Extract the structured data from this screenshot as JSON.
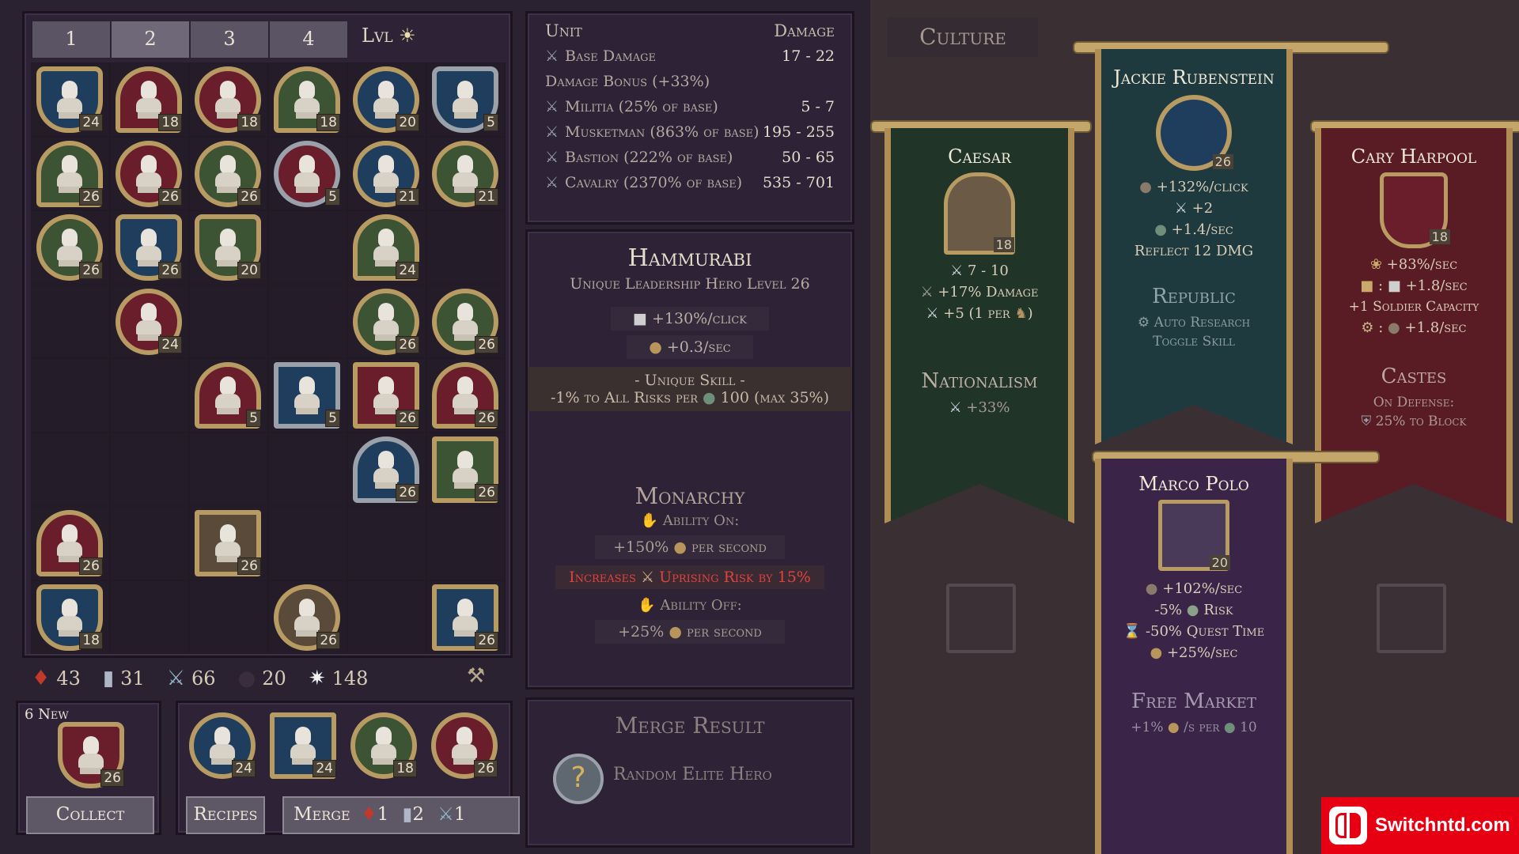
{
  "tabs": [
    "1",
    "2",
    "3",
    "4"
  ],
  "lvl_label": "Lvl",
  "heroes": [
    {
      "r": 0,
      "c": 0,
      "shape": "shield",
      "bg": "blue",
      "frame": "gold",
      "lvl": "24"
    },
    {
      "r": 0,
      "c": 1,
      "shape": "arch",
      "bg": "red",
      "frame": "gold",
      "lvl": "18"
    },
    {
      "r": 0,
      "c": 2,
      "shape": "circle",
      "bg": "red",
      "frame": "gold",
      "lvl": "18"
    },
    {
      "r": 0,
      "c": 3,
      "shape": "arch",
      "bg": "green",
      "frame": "gold",
      "lvl": "18"
    },
    {
      "r": 0,
      "c": 4,
      "shape": "circle",
      "bg": "blue",
      "frame": "gold",
      "lvl": "20"
    },
    {
      "r": 0,
      "c": 5,
      "shape": "shield",
      "bg": "blue",
      "frame": "silver",
      "lvl": "5"
    },
    {
      "r": 1,
      "c": 0,
      "shape": "arch",
      "bg": "green",
      "frame": "gold",
      "lvl": "26"
    },
    {
      "r": 1,
      "c": 1,
      "shape": "circle",
      "bg": "red",
      "frame": "gold",
      "lvl": "26"
    },
    {
      "r": 1,
      "c": 2,
      "shape": "circle",
      "bg": "green",
      "frame": "gold",
      "lvl": "26"
    },
    {
      "r": 1,
      "c": 3,
      "shape": "circle",
      "bg": "red",
      "frame": "silver",
      "lvl": "5"
    },
    {
      "r": 1,
      "c": 4,
      "shape": "circle",
      "bg": "blue",
      "frame": "gold",
      "lvl": "21"
    },
    {
      "r": 1,
      "c": 5,
      "shape": "circle",
      "bg": "green",
      "frame": "gold",
      "lvl": "21"
    },
    {
      "r": 2,
      "c": 0,
      "shape": "circle",
      "bg": "green",
      "frame": "gold",
      "lvl": "26"
    },
    {
      "r": 2,
      "c": 1,
      "shape": "shield",
      "bg": "blue",
      "frame": "gold",
      "lvl": "26"
    },
    {
      "r": 2,
      "c": 2,
      "shape": "shield",
      "bg": "green",
      "frame": "gold",
      "lvl": "20"
    },
    {
      "r": 2,
      "c": 4,
      "shape": "arch",
      "bg": "green",
      "frame": "gold",
      "lvl": "24"
    },
    {
      "r": 3,
      "c": 1,
      "shape": "circle",
      "bg": "red",
      "frame": "gold",
      "lvl": "24"
    },
    {
      "r": 3,
      "c": 4,
      "shape": "circle",
      "bg": "green",
      "frame": "gold",
      "lvl": "26"
    },
    {
      "r": 3,
      "c": 5,
      "shape": "circle",
      "bg": "green",
      "frame": "gold",
      "lvl": "26"
    },
    {
      "r": 4,
      "c": 2,
      "shape": "arch",
      "bg": "red",
      "frame": "gold",
      "lvl": "5"
    },
    {
      "r": 4,
      "c": 3,
      "shape": "square",
      "bg": "blue",
      "frame": "silver",
      "lvl": "5"
    },
    {
      "r": 4,
      "c": 4,
      "shape": "square",
      "bg": "red",
      "frame": "gold",
      "lvl": "26"
    },
    {
      "r": 4,
      "c": 5,
      "shape": "arch",
      "bg": "red",
      "frame": "gold",
      "lvl": "26"
    },
    {
      "r": 5,
      "c": 4,
      "shape": "arch",
      "bg": "blue",
      "frame": "silver",
      "lvl": "26"
    },
    {
      "r": 5,
      "c": 5,
      "shape": "square",
      "bg": "green",
      "frame": "gold",
      "lvl": "26"
    },
    {
      "r": 6,
      "c": 0,
      "shape": "arch",
      "bg": "red",
      "frame": "gold",
      "lvl": "26"
    },
    {
      "r": 6,
      "c": 2,
      "shape": "square",
      "bg": "portrait",
      "frame": "gold",
      "lvl": "26"
    },
    {
      "r": 7,
      "c": 0,
      "shape": "shield",
      "bg": "blue",
      "frame": "gold",
      "lvl": "18"
    },
    {
      "r": 7,
      "c": 3,
      "shape": "circle",
      "bg": "portrait",
      "frame": "gold",
      "lvl": "26"
    },
    {
      "r": 7,
      "c": 5,
      "shape": "square",
      "bg": "blue",
      "frame": "gold",
      "lvl": "26"
    }
  ],
  "resources": [
    {
      "icon": "banner-icon",
      "value": "43"
    },
    {
      "icon": "pillar-icon",
      "value": "31"
    },
    {
      "icon": "sword-icon",
      "value": "66"
    },
    {
      "icon": "orb-icon",
      "value": "20"
    },
    {
      "icon": "star-icon",
      "value": "148"
    }
  ],
  "new_label": "6 New",
  "new_hero_lvl": "26",
  "collect": "Collect",
  "recipe_heroes": [
    {
      "shape": "circle",
      "bg": "blue",
      "frame": "gold",
      "lvl": "24"
    },
    {
      "shape": "square",
      "bg": "blue",
      "frame": "gold",
      "lvl": "24"
    },
    {
      "shape": "circle",
      "bg": "green",
      "frame": "gold",
      "lvl": "18"
    },
    {
      "shape": "circle",
      "bg": "red",
      "frame": "gold",
      "lvl": "26"
    }
  ],
  "recipes": "Recipes",
  "merge": "Merge",
  "merge_costs": [
    "1",
    "2",
    "1"
  ],
  "unit": {
    "h_unit": "Unit",
    "h_damage": "Damage",
    "rows": [
      {
        "label": "Base Damage",
        "value": "17 - 22",
        "icon": true
      },
      {
        "label": "Damage Bonus (+33%)",
        "value": "",
        "icon": false
      },
      {
        "label": "Militia (25% of base)",
        "value": "5 - 7",
        "icon": true
      },
      {
        "label": "Musketman (863% of base)",
        "value": "195 - 255",
        "icon": true
      },
      {
        "label": "Bastion (222% of base)",
        "value": "50 - 65",
        "icon": true
      },
      {
        "label": "Cavalry (2370% of base)",
        "value": "535 - 701",
        "icon": true
      }
    ]
  },
  "hero": {
    "name": "Hammurabi",
    "subtitle": "Unique Leadership Hero Level 26",
    "click": "+130%/click",
    "sec": "+0.3/sec",
    "skill_title": "- Unique Skill -",
    "skill_text_a": "-1% to All Risks per",
    "skill_text_b": "100 (max 35%)",
    "policy": "Monarchy",
    "ability_on": "Ability On:",
    "on_value": "+150%",
    "per_second": "per second",
    "increases": "Increases",
    "uprising": "Uprising Risk by 15%",
    "ability_off": "Ability Off:",
    "off_value": "+25%"
  },
  "merge_panel": {
    "title": "Merge Result",
    "result": "Random Elite Hero"
  },
  "culture": {
    "title": "Culture",
    "caesar": {
      "name": "Caesar",
      "lvl": "18",
      "l1": "7 - 10",
      "l2": "+17% Damage",
      "l3a": "+5 (1 per",
      "l3b": ")",
      "policy": "Nationalism",
      "p1": "+33%"
    },
    "jackie": {
      "name": "Jackie Rubenstein",
      "lvl": "26",
      "l1": "+132%/click",
      "l2": "+2",
      "l3": "+1.4/sec",
      "l4": "Reflect 12 DMG",
      "policy": "Republic",
      "p1": "Auto Research",
      "p2": "Toggle Skill"
    },
    "cary": {
      "name": "Cary Harpool",
      "lvl": "18",
      "l1": "+83%/sec",
      "l2a": ":",
      "l2b": "+1.8/sec",
      "l3": "+1 Soldier Capacity",
      "l4a": ":",
      "l4b": "+1.8/sec",
      "policy": "Castes",
      "p1": "On Defense:",
      "p2": "25% to Block"
    },
    "marco": {
      "name": "Marco Polo",
      "lvl": "20",
      "l1": "+102%/sec",
      "l2a": "-5%",
      "l2b": "Risk",
      "l3": "-50% Quest Time",
      "l4": "+25%/sec",
      "policy": "Free Market",
      "p1a": "+1%",
      "p1b": "/s per",
      "p1c": "10"
    }
  },
  "watermark": "Switchntd.com",
  "colors": {
    "gold": "#b89b62",
    "red_text": "#e0433e",
    "panel": "#2d2236"
  }
}
